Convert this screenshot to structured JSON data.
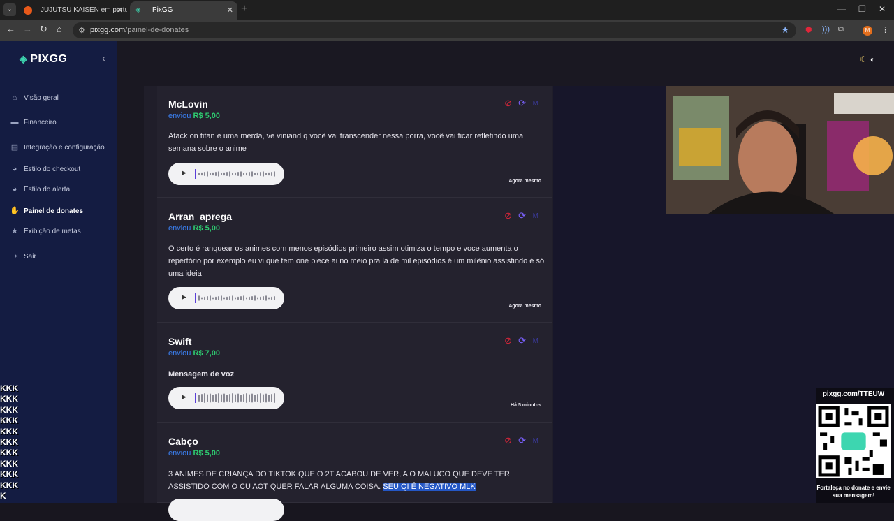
{
  "browser": {
    "tabs": [
      {
        "title": "JUJUTSU KAISEN em portuguê",
        "active": false
      },
      {
        "title": "PixGG",
        "active": true
      }
    ],
    "url_host": "pixgg.com",
    "url_path": "/painel-de-donates",
    "profile_initial": "M"
  },
  "sidebar": {
    "logo": "PIXGG",
    "items": [
      {
        "label": "Visão geral",
        "icon": "home-icon"
      },
      {
        "label": "Financeiro",
        "icon": "wallet-icon"
      },
      {
        "label": "Integração e configuração",
        "icon": "settings-icon"
      },
      {
        "label": "Estilo do checkout",
        "icon": "palette-icon"
      },
      {
        "label": "Estilo do alerta",
        "icon": "palette-icon"
      },
      {
        "label": "Painel de donates",
        "icon": "donate-icon",
        "active": true
      },
      {
        "label": "Exibição de metas",
        "icon": "star-icon"
      },
      {
        "label": "Sair",
        "icon": "logout-icon"
      }
    ]
  },
  "donates": [
    {
      "name": "McLovin",
      "sent_label": "enviou",
      "amount": "R$ 5,00",
      "message": "Atack on titan é uma merda, ve viniand q você vai transcender nessa porra, você vai ficar refletindo uma semana sobre o anime",
      "time": "Agora mesmo"
    },
    {
      "name": "Arran_aprega",
      "sent_label": "enviou",
      "amount": "R$ 5,00",
      "message": "O certo é ranquear os animes com menos episódios primeiro assim otimiza o tempo e voce aumenta o repertório por exemplo eu vi que tem one piece ai no meio pra la de mil episódios é um milênio assistindo é só uma ideia",
      "time": "Agora mesmo"
    },
    {
      "name": "Swift",
      "sent_label": "enviou",
      "amount": "R$ 7,00",
      "message": "Mensagem de voz",
      "time": "Há 5 minutos"
    },
    {
      "name": "Cabço",
      "sent_label": "enviou",
      "amount": "R$ 5,00",
      "message": "3 ANIMES DE CRIANÇA DO TIKTOK QUE O 2T ACABOU DE VER, A O MALUCO QUE DEVE TER ASSISTIDO COM O CU AOT QUER FALAR ALGUMA COISA.",
      "message_highlight": "SEU QI É NEGATIVO MLK"
    }
  ],
  "overlay": {
    "qr_url": "pixgg.com/TTEUW",
    "qr_caption": "Fortaleça no donate e envie sua mensagem!",
    "chat_lines": [
      "KKK",
      "KKK",
      "KKK",
      "KKK",
      "KKK",
      "KKK",
      "KKK",
      "KKK",
      "KKK",
      "KKK",
      "K"
    ]
  },
  "colors": {
    "sidebar": "#141c42",
    "accent_teal": "#3dd6b0",
    "amount_green": "#2ecc71",
    "sent_blue": "#3b82f6",
    "block_red": "#e0263a"
  }
}
